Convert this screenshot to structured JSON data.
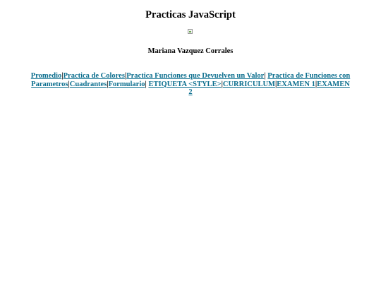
{
  "page": {
    "title": "Practicas JavaScript",
    "author": "Mariana Vazquez Corrales"
  },
  "nav": {
    "links": [
      "Promedio",
      "Practica de Colores",
      "Practica Funciones que Devuelven un Valor",
      "Practica de Funciones con Parametros",
      "Cuadrantes",
      "Formulario",
      "ETIQUETA <STYLE>",
      "CURRICULUM",
      "EXAMEN 1",
      "EXAMEN 2"
    ],
    "separator": "|",
    "link_color": "#0b6e8e"
  }
}
